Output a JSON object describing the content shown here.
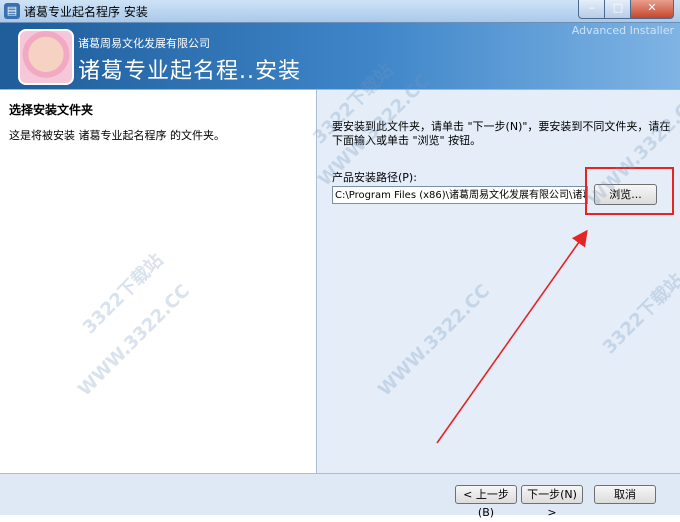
{
  "window": {
    "title": "诸葛专业起名程序 安装",
    "minimize_glyph": "–",
    "maximize_glyph": "□",
    "close_glyph": "✕"
  },
  "banner": {
    "brand": "Advanced Installer",
    "company": "诸葛周易文化发展有限公司",
    "product": "诸葛专业起名程..安装"
  },
  "left": {
    "title": "选择安装文件夹",
    "description": "这是将被安装 诸葛专业起名程序 的文件夹。"
  },
  "right": {
    "instruction": "要安装到此文件夹，请单击 \"下一步(N)\"，要安装到不同文件夹，请在下面输入或单击 \"浏览\" 按钮。",
    "path_label": "产品安装路径(P):",
    "path_value": "C:\\Program Files (x86)\\诸葛周易文化发展有限公司\\诸葛",
    "browse_label": "浏览..."
  },
  "buttons": {
    "back": "< 上一步(B)",
    "next": "下一步(N) >",
    "cancel": "取消"
  },
  "watermarks": [
    "WWW.3322.CC",
    "3322下载站"
  ],
  "colors": {
    "highlight": "#e52424",
    "banner": "#2f74b8"
  }
}
